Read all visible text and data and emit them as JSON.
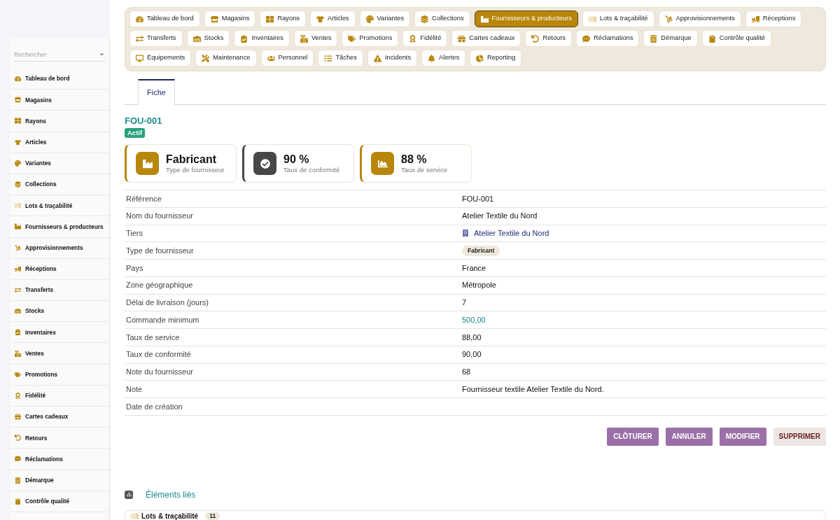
{
  "sidebar": {
    "search": {
      "placeholder": "Rechercher"
    },
    "items": [
      "Tableau de bord",
      "Magasins",
      "Rayons",
      "Articles",
      "Variantes",
      "Collections",
      "Lots & traçabilité",
      "Fournisseurs & producteurs",
      "Approvisionnements",
      "Réceptions",
      "Transferts",
      "Stocks",
      "Inventaires",
      "Ventes",
      "Promotions",
      "Fidélité",
      "Cartes cadeaux",
      "Retours",
      "Réclamations",
      "Démarque",
      "Contrôle qualité"
    ]
  },
  "nav": {
    "items": [
      {
        "label": "Tableau de bord",
        "selected": false
      },
      {
        "label": "Magasins",
        "selected": false
      },
      {
        "label": "Rayons",
        "selected": false
      },
      {
        "label": "Articles",
        "selected": false
      },
      {
        "label": "Variantes",
        "selected": false
      },
      {
        "label": "Collections",
        "selected": false
      },
      {
        "label": "Fournisseurs & producteurs",
        "selected": true
      },
      {
        "label": "Lots & traçabilité",
        "selected": false
      },
      {
        "label": "Approvisionnements",
        "selected": false
      },
      {
        "label": "Réceptions",
        "selected": false
      },
      {
        "label": "Transferts",
        "selected": false
      },
      {
        "label": "Stocks",
        "selected": false
      },
      {
        "label": "Inventaires",
        "selected": false
      },
      {
        "label": "Ventes",
        "selected": false
      },
      {
        "label": "Promotions",
        "selected": false
      },
      {
        "label": "Fidélité",
        "selected": false
      },
      {
        "label": "Cartes cadeaux",
        "selected": false
      },
      {
        "label": "Retours",
        "selected": false
      },
      {
        "label": "Réclamations",
        "selected": false
      },
      {
        "label": "Démarque",
        "selected": false
      },
      {
        "label": "Contrôle qualité",
        "selected": false
      },
      {
        "label": "Équipements",
        "selected": false
      },
      {
        "label": "Maintenance",
        "selected": false
      },
      {
        "label": "Personnel",
        "selected": false
      },
      {
        "label": "Tâches",
        "selected": false
      },
      {
        "label": "Incidents",
        "selected": false
      },
      {
        "label": "Alertes",
        "selected": false
      },
      {
        "label": "Reporting",
        "selected": false
      }
    ]
  },
  "tabs": [
    {
      "label": "Fiche",
      "selected": true
    }
  ],
  "record": {
    "title": "FOU-001",
    "status": "Actif"
  },
  "cards": [
    {
      "value": "Fabricant",
      "label": "Type de fournisseur",
      "color": "#b8860b"
    },
    {
      "value": "90 %",
      "label": "Taux de conformité",
      "color": "#474747"
    },
    {
      "value": "88 %",
      "label": "Taux de service",
      "color": "#b8860b"
    }
  ],
  "details": [
    {
      "label": "Référence",
      "value": "FOU-001",
      "kind": "text"
    },
    {
      "label": "Nom du fournisseur",
      "value": "Atelier Textile du Nord",
      "kind": "text"
    },
    {
      "label": "Tiers",
      "value": "Atelier Textile du Nord",
      "kind": "link"
    },
    {
      "label": "Type de fournisseur",
      "value": "Fabricant",
      "kind": "badge"
    },
    {
      "label": "Pays",
      "value": "France",
      "kind": "text"
    },
    {
      "label": "Zone géographique",
      "value": "Métropole",
      "kind": "text"
    },
    {
      "label": "Délai de livraison (jours)",
      "value": "7",
      "kind": "text"
    },
    {
      "label": "Commande minimum",
      "value": "500,00",
      "kind": "amount"
    },
    {
      "label": "Taux de service",
      "value": "88,00",
      "kind": "text"
    },
    {
      "label": "Taux de conformité",
      "value": "90,00",
      "kind": "text"
    },
    {
      "label": "Note du fournisseur",
      "value": "68",
      "kind": "text"
    },
    {
      "label": "Note",
      "value": "Fournisseur textile Atelier Textile du Nord.",
      "kind": "text"
    },
    {
      "label": "Date de création"
    }
  ],
  "actions": [
    {
      "label": "CLÔTURER",
      "kind": "primary"
    },
    {
      "label": "ANNULER",
      "kind": "primary"
    },
    {
      "label": "MODIFIER",
      "kind": "primary"
    },
    {
      "label": "SUPPRIMER",
      "kind": "danger"
    }
  ],
  "related": {
    "title": "Éléments liés",
    "groups": [
      {
        "label": "Lots & traçabilité",
        "count": "11"
      }
    ]
  }
}
